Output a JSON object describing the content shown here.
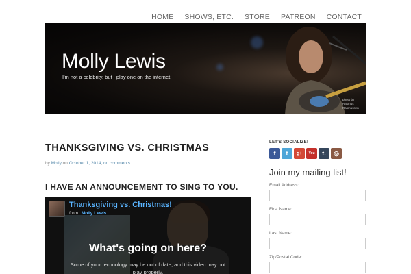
{
  "nav": {
    "items": [
      {
        "label": "HOME"
      },
      {
        "label": "SHOWS, ETC."
      },
      {
        "label": "STORE"
      },
      {
        "label": "PATREON"
      },
      {
        "label": "CONTACT"
      }
    ]
  },
  "banner": {
    "title": "Molly Lewis",
    "tagline": "I'm not a celebrity, but I play one on the internet.",
    "photo_credit": "photo by Rasmus Rasmussen"
  },
  "post": {
    "title": "THANKSGIVING VS. CHRISTMAS",
    "meta_prefix": "by",
    "author": "Molly",
    "meta_on": "on",
    "date": "October 1, 2014",
    "comments": "no comments",
    "announcement": "I HAVE AN ANNOUNCEMENT TO SING TO YOU."
  },
  "video": {
    "title": "Thanksgiving vs. Christmas!",
    "from_label": "from",
    "author": "Molly Lewis",
    "headline": "What's going on here?",
    "message": "Some of your technology may be out of date, and this video may not play properly."
  },
  "sidebar": {
    "social_heading": "LET'S SOCIALIZE!",
    "social_icons": [
      {
        "name": "facebook-icon",
        "glyph": "f",
        "color": "#3b5998"
      },
      {
        "name": "twitter-icon",
        "glyph": "t",
        "color": "#4ea6d8"
      },
      {
        "name": "google-plus-icon",
        "glyph": "g+",
        "color": "#d34836"
      },
      {
        "name": "youtube-icon",
        "glyph": "You",
        "color": "#c4302b"
      },
      {
        "name": "tumblr-icon",
        "glyph": "t.",
        "color": "#35465c"
      },
      {
        "name": "instagram-icon",
        "glyph": "◎",
        "color": "#8a5a44"
      }
    ],
    "mailing_heading": "Join my mailing list!",
    "fields": [
      {
        "label": "Email Address:",
        "value": ""
      },
      {
        "label": "First Name:",
        "value": ""
      },
      {
        "label": "Last Name:",
        "value": ""
      },
      {
        "label": "Zip/Postal Code:",
        "value": ""
      }
    ]
  }
}
